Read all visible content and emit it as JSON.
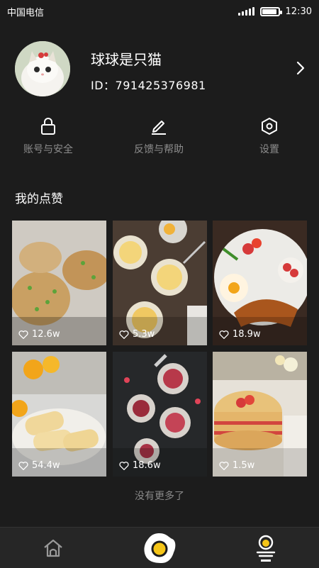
{
  "status_bar": {
    "carrier": "中国电信",
    "time": "12:30",
    "battery_level": 0.9
  },
  "profile": {
    "username": "球球是只猫",
    "id_text": "ID：791425376981"
  },
  "actions": [
    {
      "label": "账号与安全",
      "icon": "lock-icon"
    },
    {
      "label": "反馈与帮助",
      "icon": "edit-icon"
    },
    {
      "label": "设置",
      "icon": "settings-icon"
    }
  ],
  "section_title": "我的点赞",
  "posts": [
    {
      "likes": "12.6w"
    },
    {
      "likes": "5.3w"
    },
    {
      "likes": "18.9w"
    },
    {
      "likes": "54.4w"
    },
    {
      "likes": "18.6w"
    },
    {
      "likes": "1.5w"
    }
  ],
  "no_more_text": "没有更多了",
  "tabbar": {
    "tabs": [
      "home-icon",
      "egg-icon",
      "profile-icon"
    ],
    "active": "profile-icon",
    "accent": "#f5c518"
  }
}
